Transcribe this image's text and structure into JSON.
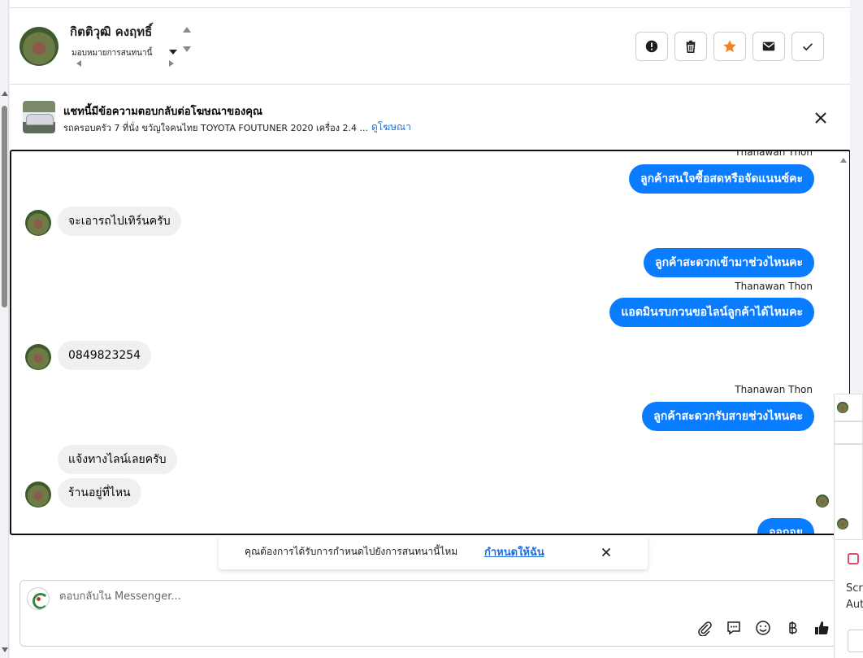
{
  "header": {
    "contact_name": "กิตติวุฒิ คงฤทธิ์",
    "assign_label": "มอบหมายการสนทนานี้"
  },
  "actions": {
    "spam_icon": "exclamation-circle-icon",
    "delete_icon": "trash-icon",
    "star_icon": "star-icon",
    "star_color": "#f5821f",
    "unread_icon": "envelope-icon",
    "done_icon": "check-icon"
  },
  "ad": {
    "title": "แชทนี้มีข้อความตอบกลับต่อโฆษณาของคุณ",
    "description": "รถครอบครัว 7 ที่นั่ง ขวัญใจคนไทย TOYOTA FOUTUNER 2020 เครื่อง 2.4 ...",
    "link": "ดูโฆษณา"
  },
  "messages": [
    {
      "from": "agent",
      "sender": "Thanawan Thon",
      "text": "ลูกค้าสนใจซื้อสดหรือจัดแนนซ์คะ"
    },
    {
      "from": "customer",
      "text": "จะเอารถไปเทิร์นครับ"
    },
    {
      "from": "agent",
      "text": "ลูกค้าสะดวกเข้ามาช่วงไหนคะ"
    },
    {
      "from": "agent",
      "sender": "Thanawan Thon",
      "text": "แอดมินรบกวนขอไลน์ลูกค้าได้ไหมคะ"
    },
    {
      "from": "customer",
      "text": "0849823254"
    },
    {
      "from": "agent",
      "sender": "Thanawan Thon",
      "text": "ลูกค้าสะดวกรับสายช่วงไหนคะ"
    },
    {
      "from": "customer",
      "text": "แจ้งทางไลน์เลยครับ"
    },
    {
      "from": "customer",
      "text": "ร้านอยู่ที่ไหน"
    },
    {
      "from": "agent",
      "text": "ออกอย"
    }
  ],
  "label_suggestion": {
    "text": "คุณต้องการได้รับการกำหนดไปยังการสนทนานี้ไหม",
    "link": "กำหนดให้ฉัน"
  },
  "composer": {
    "placeholder": "ตอบกลับใน Messenger...",
    "tools": [
      "paperclip-icon",
      "saved-reply-icon",
      "emoji-icon",
      "baht-icon",
      "thumbs-up-icon"
    ]
  },
  "overlay": {
    "text1": "Scre",
    "text2": "Aut"
  },
  "colors": {
    "outgoing_bubble": "#0a7cff",
    "incoming_bubble": "#f0f0f0",
    "link": "#216fdb"
  }
}
